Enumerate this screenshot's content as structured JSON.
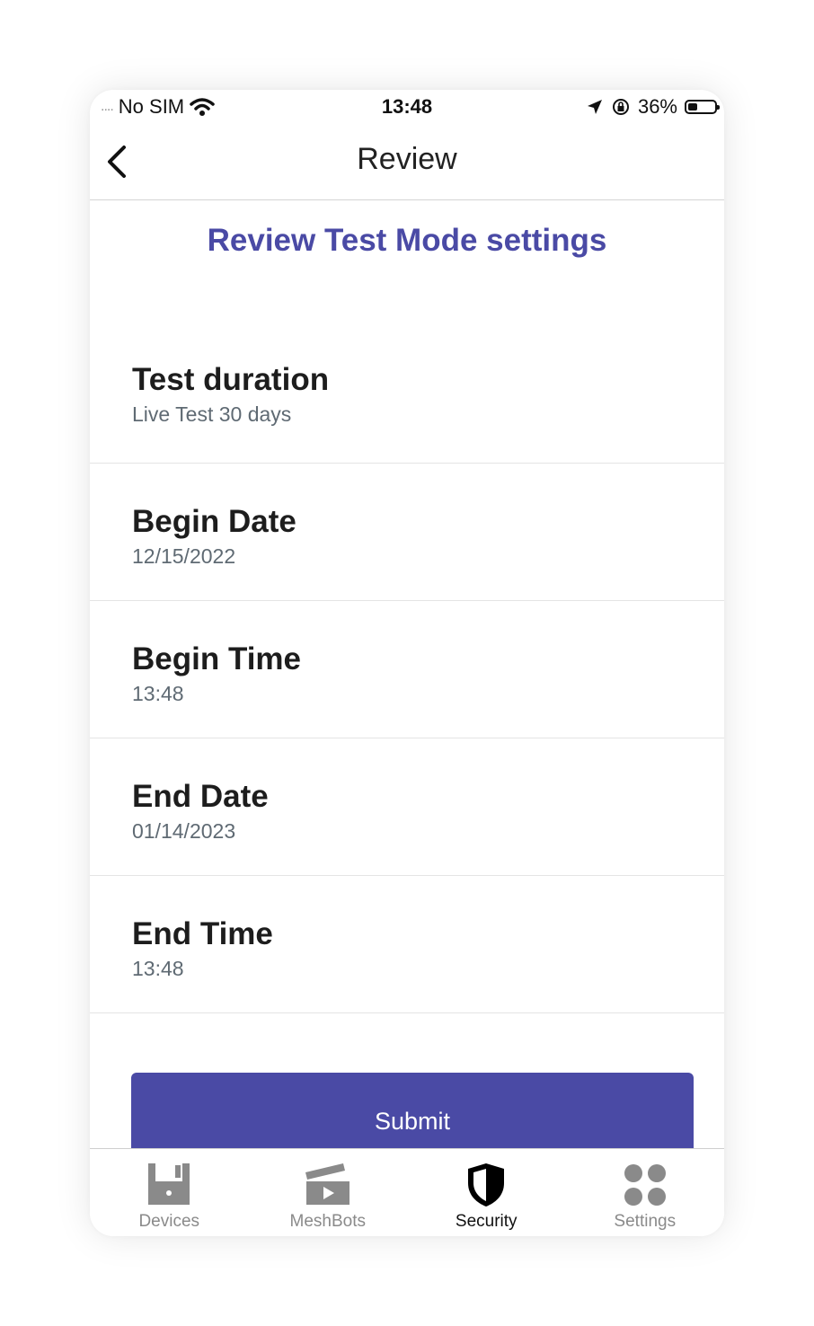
{
  "status_bar": {
    "signal": "....",
    "carrier": "No SIM",
    "time": "13:48",
    "battery_percent": "36%",
    "battery_level": 0.36
  },
  "nav": {
    "title": "Review",
    "back_icon": "chevron-left-icon"
  },
  "subtitle": "Review Test Mode settings",
  "settings": [
    {
      "label": "Test duration",
      "value": "Live Test 30 days"
    },
    {
      "label": "Begin Date",
      "value": "12/15/2022"
    },
    {
      "label": "Begin Time",
      "value": "13:48"
    },
    {
      "label": "End Date",
      "value": "01/14/2023"
    },
    {
      "label": "End Time",
      "value": "13:48"
    }
  ],
  "submit_label": "Submit",
  "tabs": [
    {
      "label": "Devices",
      "icon": "devices-icon"
    },
    {
      "label": "MeshBots",
      "icon": "meshbots-icon"
    },
    {
      "label": "Security",
      "icon": "shield-icon",
      "active": true
    },
    {
      "label": "Settings",
      "icon": "settings-dots-icon"
    }
  ],
  "colors": {
    "accent": "#4a4aa5",
    "text_primary": "#1d1d1d",
    "text_secondary": "#5f6a73",
    "tab_inactive": "#8a8a8a"
  }
}
